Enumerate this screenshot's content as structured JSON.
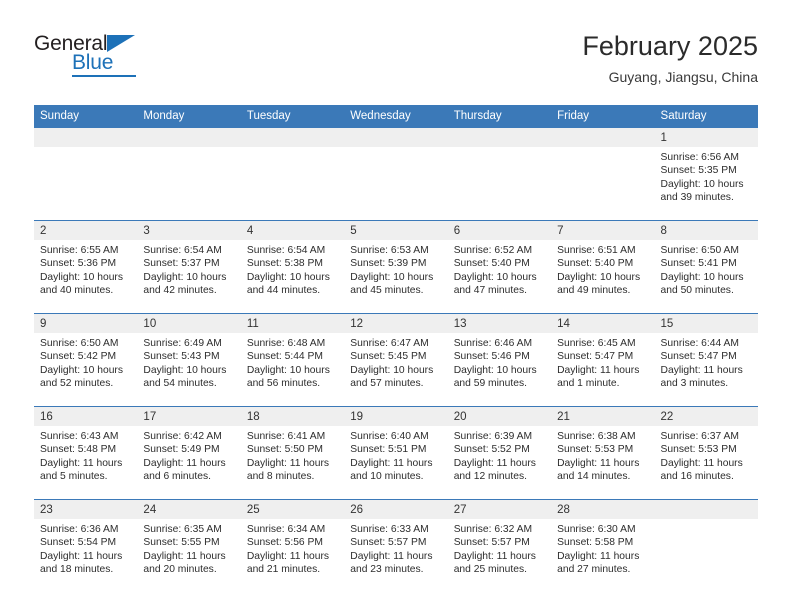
{
  "brand": {
    "name_top": "General",
    "name_bottom": "Blue",
    "accent_color": "#1d71b8",
    "triangle_icon": "triangle-icon"
  },
  "header": {
    "title": "February 2025",
    "location": "Guyang, Jiangsu, China"
  },
  "theme": {
    "header_row_bg": "#3b79b8",
    "row_border": "#3b79b8",
    "daynum_band_bg": "#efefef",
    "text": "#2d2d2d"
  },
  "weekday_headers": [
    "Sunday",
    "Monday",
    "Tuesday",
    "Wednesday",
    "Thursday",
    "Friday",
    "Saturday"
  ],
  "weeks": [
    [
      {
        "day": "",
        "empty": true
      },
      {
        "day": "",
        "empty": true
      },
      {
        "day": "",
        "empty": true
      },
      {
        "day": "",
        "empty": true
      },
      {
        "day": "",
        "empty": true
      },
      {
        "day": "",
        "empty": true
      },
      {
        "day": "1",
        "sunrise": "Sunrise: 6:56 AM",
        "sunset": "Sunset: 5:35 PM",
        "daylight": "Daylight: 10 hours and 39 minutes."
      }
    ],
    [
      {
        "day": "2",
        "sunrise": "Sunrise: 6:55 AM",
        "sunset": "Sunset: 5:36 PM",
        "daylight": "Daylight: 10 hours and 40 minutes."
      },
      {
        "day": "3",
        "sunrise": "Sunrise: 6:54 AM",
        "sunset": "Sunset: 5:37 PM",
        "daylight": "Daylight: 10 hours and 42 minutes."
      },
      {
        "day": "4",
        "sunrise": "Sunrise: 6:54 AM",
        "sunset": "Sunset: 5:38 PM",
        "daylight": "Daylight: 10 hours and 44 minutes."
      },
      {
        "day": "5",
        "sunrise": "Sunrise: 6:53 AM",
        "sunset": "Sunset: 5:39 PM",
        "daylight": "Daylight: 10 hours and 45 minutes."
      },
      {
        "day": "6",
        "sunrise": "Sunrise: 6:52 AM",
        "sunset": "Sunset: 5:40 PM",
        "daylight": "Daylight: 10 hours and 47 minutes."
      },
      {
        "day": "7",
        "sunrise": "Sunrise: 6:51 AM",
        "sunset": "Sunset: 5:40 PM",
        "daylight": "Daylight: 10 hours and 49 minutes."
      },
      {
        "day": "8",
        "sunrise": "Sunrise: 6:50 AM",
        "sunset": "Sunset: 5:41 PM",
        "daylight": "Daylight: 10 hours and 50 minutes."
      }
    ],
    [
      {
        "day": "9",
        "sunrise": "Sunrise: 6:50 AM",
        "sunset": "Sunset: 5:42 PM",
        "daylight": "Daylight: 10 hours and 52 minutes."
      },
      {
        "day": "10",
        "sunrise": "Sunrise: 6:49 AM",
        "sunset": "Sunset: 5:43 PM",
        "daylight": "Daylight: 10 hours and 54 minutes."
      },
      {
        "day": "11",
        "sunrise": "Sunrise: 6:48 AM",
        "sunset": "Sunset: 5:44 PM",
        "daylight": "Daylight: 10 hours and 56 minutes."
      },
      {
        "day": "12",
        "sunrise": "Sunrise: 6:47 AM",
        "sunset": "Sunset: 5:45 PM",
        "daylight": "Daylight: 10 hours and 57 minutes."
      },
      {
        "day": "13",
        "sunrise": "Sunrise: 6:46 AM",
        "sunset": "Sunset: 5:46 PM",
        "daylight": "Daylight: 10 hours and 59 minutes."
      },
      {
        "day": "14",
        "sunrise": "Sunrise: 6:45 AM",
        "sunset": "Sunset: 5:47 PM",
        "daylight": "Daylight: 11 hours and 1 minute."
      },
      {
        "day": "15",
        "sunrise": "Sunrise: 6:44 AM",
        "sunset": "Sunset: 5:47 PM",
        "daylight": "Daylight: 11 hours and 3 minutes."
      }
    ],
    [
      {
        "day": "16",
        "sunrise": "Sunrise: 6:43 AM",
        "sunset": "Sunset: 5:48 PM",
        "daylight": "Daylight: 11 hours and 5 minutes."
      },
      {
        "day": "17",
        "sunrise": "Sunrise: 6:42 AM",
        "sunset": "Sunset: 5:49 PM",
        "daylight": "Daylight: 11 hours and 6 minutes."
      },
      {
        "day": "18",
        "sunrise": "Sunrise: 6:41 AM",
        "sunset": "Sunset: 5:50 PM",
        "daylight": "Daylight: 11 hours and 8 minutes."
      },
      {
        "day": "19",
        "sunrise": "Sunrise: 6:40 AM",
        "sunset": "Sunset: 5:51 PM",
        "daylight": "Daylight: 11 hours and 10 minutes."
      },
      {
        "day": "20",
        "sunrise": "Sunrise: 6:39 AM",
        "sunset": "Sunset: 5:52 PM",
        "daylight": "Daylight: 11 hours and 12 minutes."
      },
      {
        "day": "21",
        "sunrise": "Sunrise: 6:38 AM",
        "sunset": "Sunset: 5:53 PM",
        "daylight": "Daylight: 11 hours and 14 minutes."
      },
      {
        "day": "22",
        "sunrise": "Sunrise: 6:37 AM",
        "sunset": "Sunset: 5:53 PM",
        "daylight": "Daylight: 11 hours and 16 minutes."
      }
    ],
    [
      {
        "day": "23",
        "sunrise": "Sunrise: 6:36 AM",
        "sunset": "Sunset: 5:54 PM",
        "daylight": "Daylight: 11 hours and 18 minutes."
      },
      {
        "day": "24",
        "sunrise": "Sunrise: 6:35 AM",
        "sunset": "Sunset: 5:55 PM",
        "daylight": "Daylight: 11 hours and 20 minutes."
      },
      {
        "day": "25",
        "sunrise": "Sunrise: 6:34 AM",
        "sunset": "Sunset: 5:56 PM",
        "daylight": "Daylight: 11 hours and 21 minutes."
      },
      {
        "day": "26",
        "sunrise": "Sunrise: 6:33 AM",
        "sunset": "Sunset: 5:57 PM",
        "daylight": "Daylight: 11 hours and 23 minutes."
      },
      {
        "day": "27",
        "sunrise": "Sunrise: 6:32 AM",
        "sunset": "Sunset: 5:57 PM",
        "daylight": "Daylight: 11 hours and 25 minutes."
      },
      {
        "day": "28",
        "sunrise": "Sunrise: 6:30 AM",
        "sunset": "Sunset: 5:58 PM",
        "daylight": "Daylight: 11 hours and 27 minutes."
      },
      {
        "day": "",
        "empty": true
      }
    ]
  ]
}
